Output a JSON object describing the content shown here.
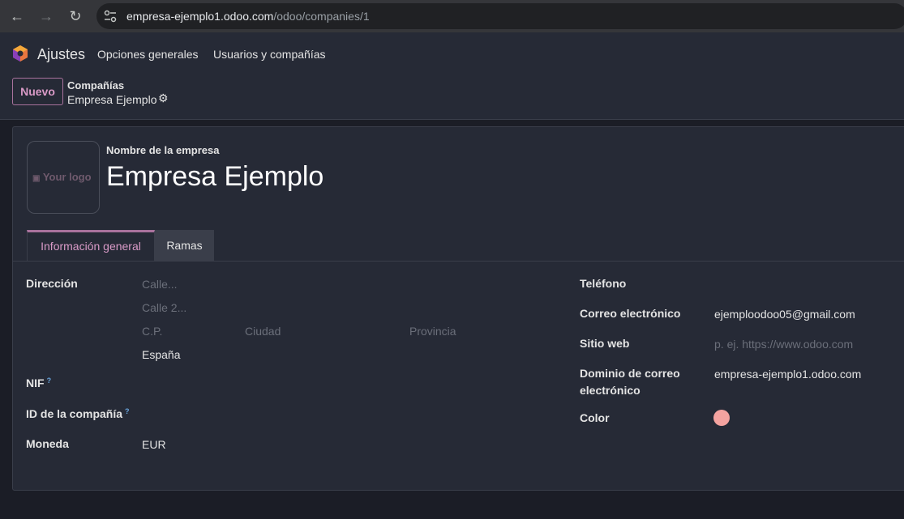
{
  "browser": {
    "url_host": "empresa-ejemplo1.odoo.com",
    "url_path": "/odoo/companies/1"
  },
  "navbar": {
    "app_name": "Ajustes",
    "menu": [
      "Opciones generales",
      "Usuarios y compañías"
    ]
  },
  "control": {
    "new_button": "Nuevo",
    "breadcrumb_parent": "Compañías",
    "breadcrumb_current": "Empresa Ejemplo"
  },
  "form": {
    "logo_placeholder": "Your logo",
    "name_label": "Nombre de la empresa",
    "name_value": "Empresa Ejemplo",
    "tabs": [
      "Información general",
      "Ramas"
    ],
    "address": {
      "label": "Dirección",
      "street_placeholder": "Calle...",
      "street2_placeholder": "Calle 2...",
      "zip_placeholder": "C.P.",
      "city_placeholder": "Ciudad",
      "state_placeholder": "Provincia",
      "country": "España"
    },
    "vat_label": "NIF",
    "company_id_label": "ID de la compañía",
    "help_mark": "?",
    "currency_label": "Moneda",
    "currency_value": "EUR",
    "phone_label": "Teléfono",
    "email_label": "Correo electrónico",
    "email_value": "ejemploodoo05@gmail.com",
    "website_label": "Sitio web",
    "website_placeholder": "p. ej. https://www.odoo.com",
    "domain_label_line1": "Dominio de correo",
    "domain_label_line2": "electrónico",
    "domain_value": "empresa-ejemplo1.odoo.com",
    "color_label": "Color",
    "color_value": "#f4a3a0"
  },
  "colors": {
    "accent": "#a9729d",
    "background": "#1b1d26",
    "panel": "#262a36"
  }
}
